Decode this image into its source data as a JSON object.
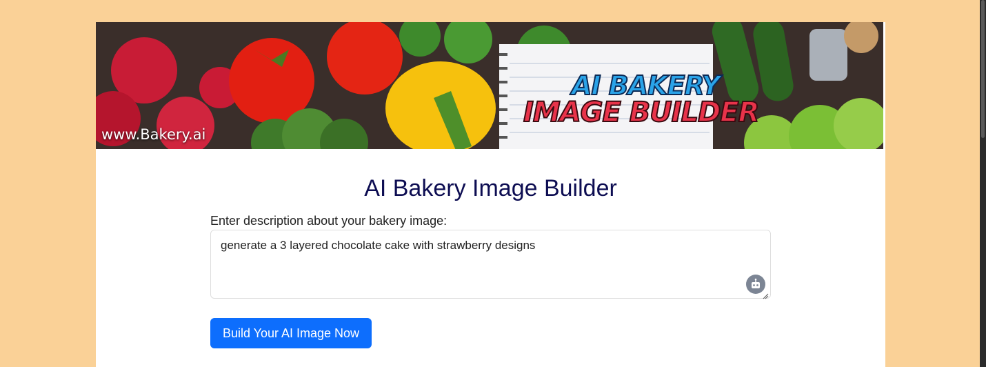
{
  "banner": {
    "site_url": "www.Bakery.ai",
    "title_line1": "AI BAKERY",
    "title_line2": "IMAGE BUILDER"
  },
  "main": {
    "title": "AI Bakery Image Builder",
    "description_label": "Enter description about your bakery image:",
    "description_value": "generate a 3 layered chocolate cake with strawberry designs",
    "build_button_label": "Build Your AI Image Now"
  },
  "colors": {
    "page_background": "#fad197",
    "title_color": "#0d0d52",
    "button_color": "#0d6efd"
  },
  "icons": {
    "textarea_assistant": "bot-icon",
    "textarea_resize": "resize-grip-icon"
  }
}
